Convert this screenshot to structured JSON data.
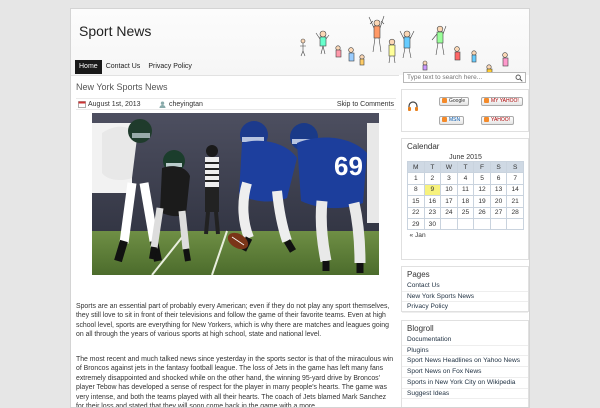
{
  "site": {
    "title": "Sport News"
  },
  "nav": [
    "Home",
    "Contact Us",
    "Privacy Policy"
  ],
  "search": {
    "placeholder": "Type text to search here..."
  },
  "post": {
    "title": "New York Sports News",
    "date": "August 1st, 2013",
    "author": "cheyingtan",
    "skip": "Skip to Comments",
    "p1": "Sports are an essential part of probably every American; even if they do not play any sport themselves, they still love to sit in front of their televisions and follow the game of their favorite teams. Even at high school level, sports are everything for New Yorkers, which is why there are matches and leagues going on all through the years of various sports at high school, state and national level.",
    "p2": "The most recent and much talked news since yesterday in the sports sector is that of the miraculous win of Broncos against jets in the fantasy football league. The loss of Jets in the game has left many fans extremely disappointed and shocked while on the other hand, the winning 95-yard drive by Broncos' player Tebow has developed a sense of respect for the player in many people's hearts. The game was very intense, and both the teams played with all their hearts.  The coach of Jets blamed Mark Sanchez for their loss and stated that they will soon come back in the game with a more"
  },
  "subscribe": {
    "google": "Google",
    "myyahoo": "MY YAHOO!",
    "msn": "MSN",
    "yahoo": "YAHOO!",
    "bloglines": "bloglines"
  },
  "calendar": {
    "title": "Calendar",
    "caption": "June 2015",
    "days": [
      "M",
      "T",
      "W",
      "T",
      "F",
      "S",
      "S"
    ],
    "weeks": [
      [
        "1",
        "2",
        "3",
        "4",
        "5",
        "6",
        "7"
      ],
      [
        "8",
        "9",
        "10",
        "11",
        "12",
        "13",
        "14"
      ],
      [
        "15",
        "16",
        "17",
        "18",
        "19",
        "20",
        "21"
      ],
      [
        "22",
        "23",
        "24",
        "25",
        "26",
        "27",
        "28"
      ],
      [
        "29",
        "30",
        "",
        "",
        "",
        "",
        ""
      ]
    ],
    "today": "9",
    "prev": "« Jan"
  },
  "pages": {
    "title": "Pages",
    "items": [
      "Contact Us",
      "New York Sports News",
      "Privacy Policy"
    ]
  },
  "blogroll": {
    "title": "Blogroll",
    "items": [
      "Documentation",
      "Plugins",
      "Sport News Headlines on Yahoo News",
      "Sport News on Fox News",
      "Sports in New York City on Wikipedia",
      "Suggest Ideas"
    ]
  }
}
